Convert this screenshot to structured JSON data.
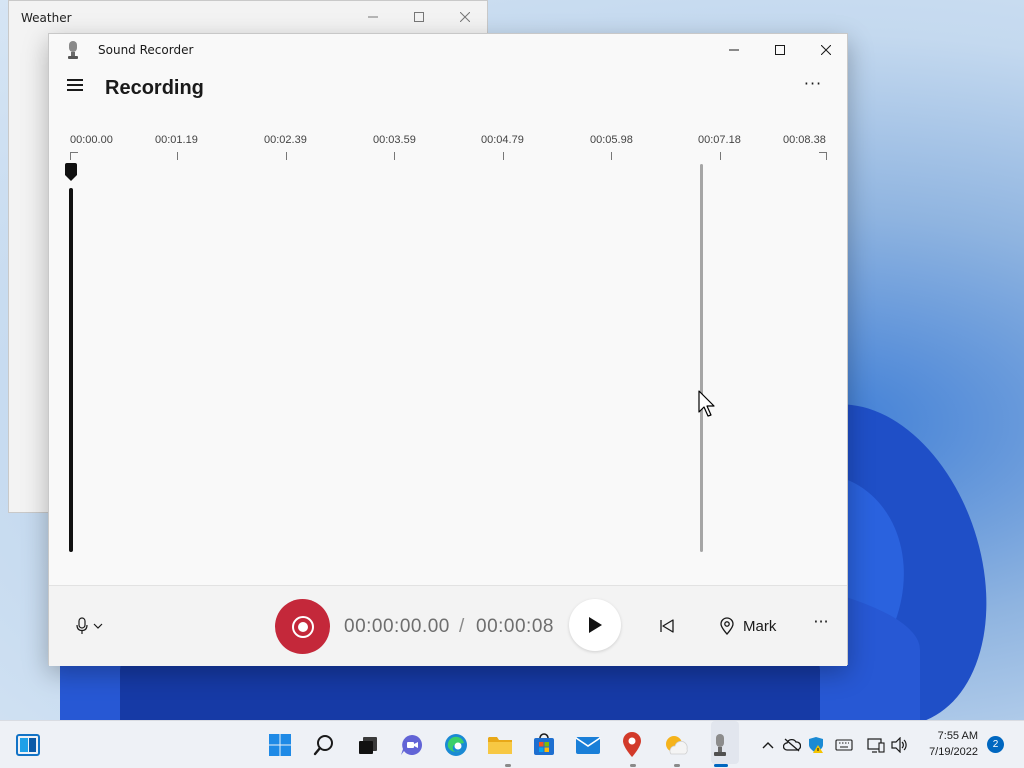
{
  "weather_window": {
    "title": "Weather"
  },
  "recorder": {
    "app_title": "Sound Recorder",
    "page_title": "Recording",
    "more_top": "···",
    "timeline_ticks": [
      "00:00.00",
      "00:01.19",
      "00:02.39",
      "00:03.59",
      "00:04.79",
      "00:05.98",
      "00:07.18",
      "00:08.38"
    ],
    "current_time": "00:00:00.00",
    "time_separator": "/",
    "total_time": "00:00:08",
    "mark_label": "Mark",
    "more_bottom": "···"
  },
  "taskbar": {
    "clock_time": "7:55 AM",
    "clock_date": "7/19/2022",
    "notification_count": "2"
  },
  "colors": {
    "record_red": "#c4283a",
    "accent_blue": "#0067c0"
  }
}
